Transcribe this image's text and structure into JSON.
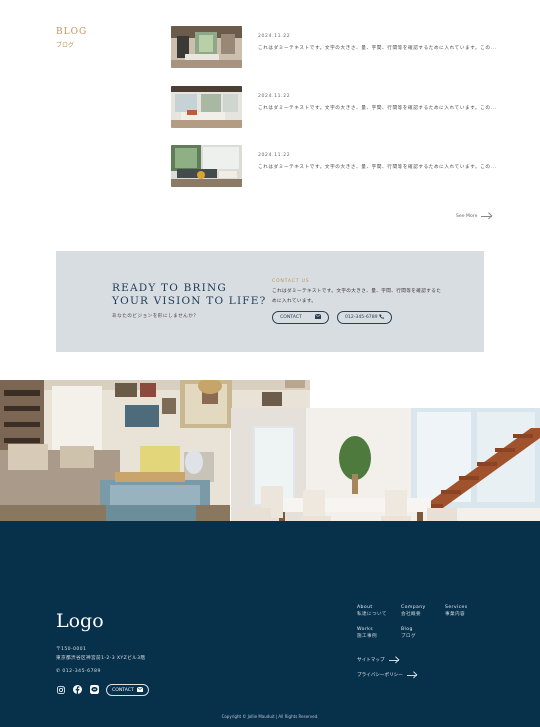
{
  "blog": {
    "title": "BLOG",
    "subtitle": "ブログ",
    "posts": [
      {
        "date": "2024.11.22",
        "text": "これはダミーテキストです。文字の大きさ、量、字間、行間等を確認するために入れています。この..."
      },
      {
        "date": "2024.11.22",
        "text": "これはダミーテキストです。文字の大きさ、量、字間、行間等を確認するために入れています。この..."
      },
      {
        "date": "2024.11.22",
        "text": "これはダミーテキストです。文字の大きさ、量、字間、行間等を確認するために入れています。この..."
      }
    ],
    "see_more": "See More"
  },
  "cta": {
    "headline_line1": "READY TO BRING",
    "headline_line2": "YOUR VISION TO LIFE?",
    "headline_sub": "あなたのビジョンを形にしませんか？",
    "label": "CONTACT US",
    "text": "これはダミーテキストです。文字の大きさ、量、字間、行間等を確認するために入れています。",
    "contact_button": "CONTACT",
    "phone_button": "012-345-6789"
  },
  "footer": {
    "logo": "Logo",
    "address_line1": "〒150-0001",
    "address_line2": "東京都渋谷区神宮前1-2-3 XYZビル3階",
    "tel": "012-345-6789",
    "contact_button": "CONTACT",
    "nav": [
      {
        "en": "About",
        "jp": "私達について"
      },
      {
        "en": "Company",
        "jp": "会社概要"
      },
      {
        "en": "Services",
        "jp": "事業内容"
      },
      {
        "en": "Works",
        "jp": "施工事例"
      },
      {
        "en": "Blog",
        "jp": "ブログ"
      }
    ],
    "sitemap": "サイトマップ",
    "privacy": "プライバシーポリシー",
    "copyright": "Copyright © Jollie Mauduit | All Rights Reserved."
  },
  "icons": {
    "mail": "mail-icon",
    "phone": "phone-icon",
    "instagram": "instagram-icon",
    "facebook": "facebook-icon",
    "line": "line-icon"
  },
  "colors": {
    "accent": "#c39558",
    "navy": "#07304b",
    "cta_bg": "#d7dde1",
    "heading": "#1e3a57"
  }
}
